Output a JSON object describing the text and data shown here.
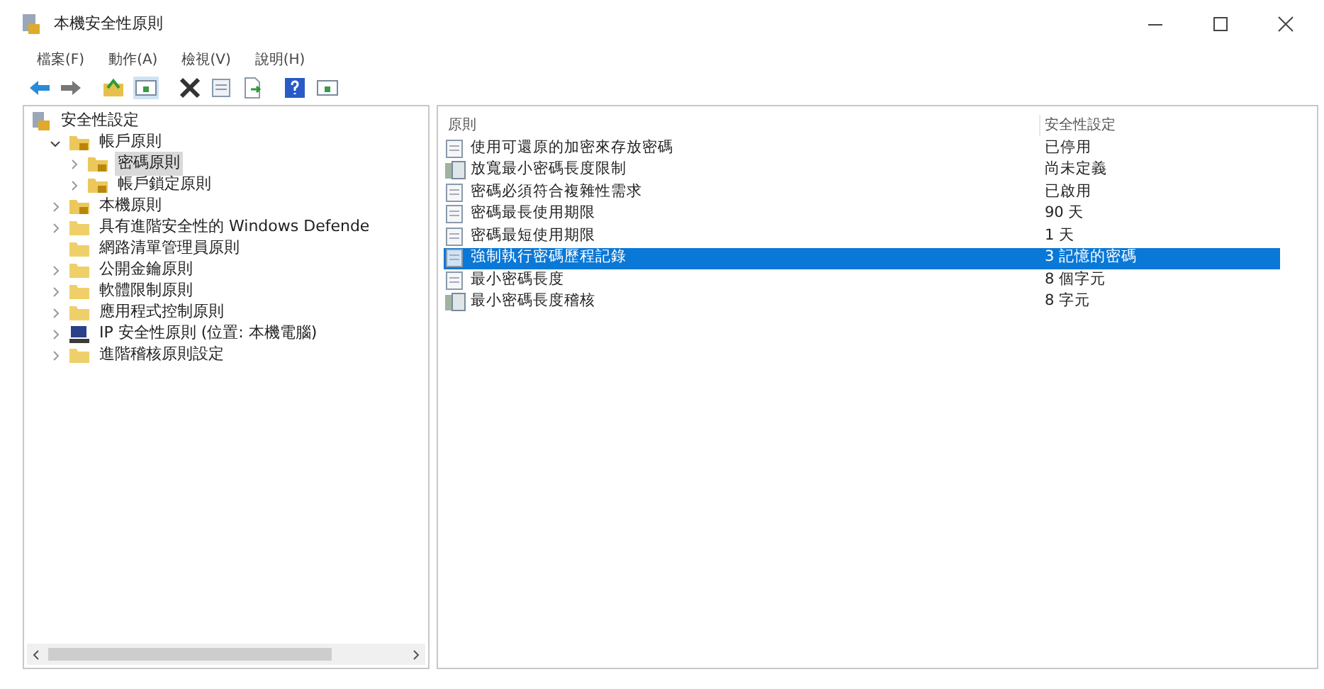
{
  "window": {
    "title": "本機安全性原則"
  },
  "menu": [
    "檔案(F)",
    "動作(A)",
    "檢視(V)",
    "說明(H)"
  ],
  "tree": [
    {
      "label": "安全性設定",
      "kind": "root",
      "selected": false,
      "children": [
        {
          "label": "帳戶原則",
          "kind": "lock-folder",
          "expanded": true,
          "selected": false,
          "children": [
            {
              "label": "密碼原則",
              "kind": "lock-folder",
              "expanded": false,
              "selected": true
            },
            {
              "label": "帳戶鎖定原則",
              "kind": "lock-folder",
              "expanded": false,
              "selected": false
            }
          ]
        },
        {
          "label": "本機原則",
          "kind": "lock-folder",
          "expanded": false,
          "selected": false
        },
        {
          "label": "具有進階安全性的 Windows Defende",
          "kind": "folder",
          "expanded": false,
          "selected": false
        },
        {
          "label": "網路清單管理員原則",
          "kind": "folder",
          "selected": false
        },
        {
          "label": "公開金鑰原則",
          "kind": "folder",
          "expanded": false,
          "selected": false
        },
        {
          "label": "軟體限制原則",
          "kind": "folder",
          "expanded": false,
          "selected": false
        },
        {
          "label": "應用程式控制原則",
          "kind": "folder",
          "expanded": false,
          "selected": false
        },
        {
          "label": "IP 安全性原則 (位置: 本機電腦)",
          "kind": "computer",
          "expanded": false,
          "selected": false
        },
        {
          "label": "進階稽核原則設定",
          "kind": "folder",
          "expanded": false,
          "selected": false
        }
      ]
    }
  ],
  "table": {
    "columns": [
      "原則",
      "安全性設定"
    ],
    "rows": [
      {
        "policy": "使用可還原的加密來存放密碼",
        "setting": "已停用",
        "kind": "doc",
        "selected": false
      },
      {
        "policy": "放寬最小密碼長度限制",
        "setting": "尚未定義",
        "kind": "server",
        "selected": false
      },
      {
        "policy": "密碼必須符合複雜性需求",
        "setting": "已啟用",
        "kind": "doc",
        "selected": false
      },
      {
        "policy": "密碼最長使用期限",
        "setting": "90 天",
        "kind": "doc",
        "selected": false
      },
      {
        "policy": "密碼最短使用期限",
        "setting": "1 天",
        "kind": "doc",
        "selected": false
      },
      {
        "policy": "強制執行密碼歷程記錄",
        "setting": "3 記憶的密碼",
        "kind": "doc",
        "selected": true
      },
      {
        "policy": "最小密碼長度",
        "setting": "8 個字元",
        "kind": "doc",
        "selected": false
      },
      {
        "policy": "最小密碼長度稽核",
        "setting": "8 字元",
        "kind": "server",
        "selected": false
      }
    ]
  }
}
